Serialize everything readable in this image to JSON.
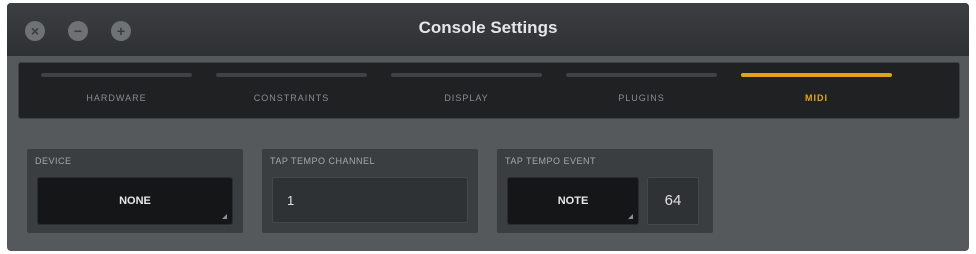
{
  "window": {
    "title": "Console Settings"
  },
  "titlebar_buttons": [
    {
      "icon": "close-icon",
      "glyph": "×"
    },
    {
      "icon": "minimize-icon",
      "glyph": "−"
    },
    {
      "icon": "zoom-icon",
      "glyph": "+"
    }
  ],
  "tabs": [
    {
      "label": "HARDWARE",
      "active": false
    },
    {
      "label": "CONSTRAINTS",
      "active": false
    },
    {
      "label": "DISPLAY",
      "active": false
    },
    {
      "label": "PLUGINS",
      "active": false
    },
    {
      "label": "MIDI",
      "active": true
    }
  ],
  "colors": {
    "accent": "#e2a21f",
    "panel": "#3b3e41",
    "background": "#55595c"
  },
  "device": {
    "label": "DEVICE",
    "value": "NONE"
  },
  "tap_tempo_channel": {
    "label": "TAP TEMPO CHANNEL",
    "value": "1"
  },
  "tap_tempo_event": {
    "label": "TAP TEMPO EVENT",
    "type": "NOTE",
    "number": "64"
  }
}
